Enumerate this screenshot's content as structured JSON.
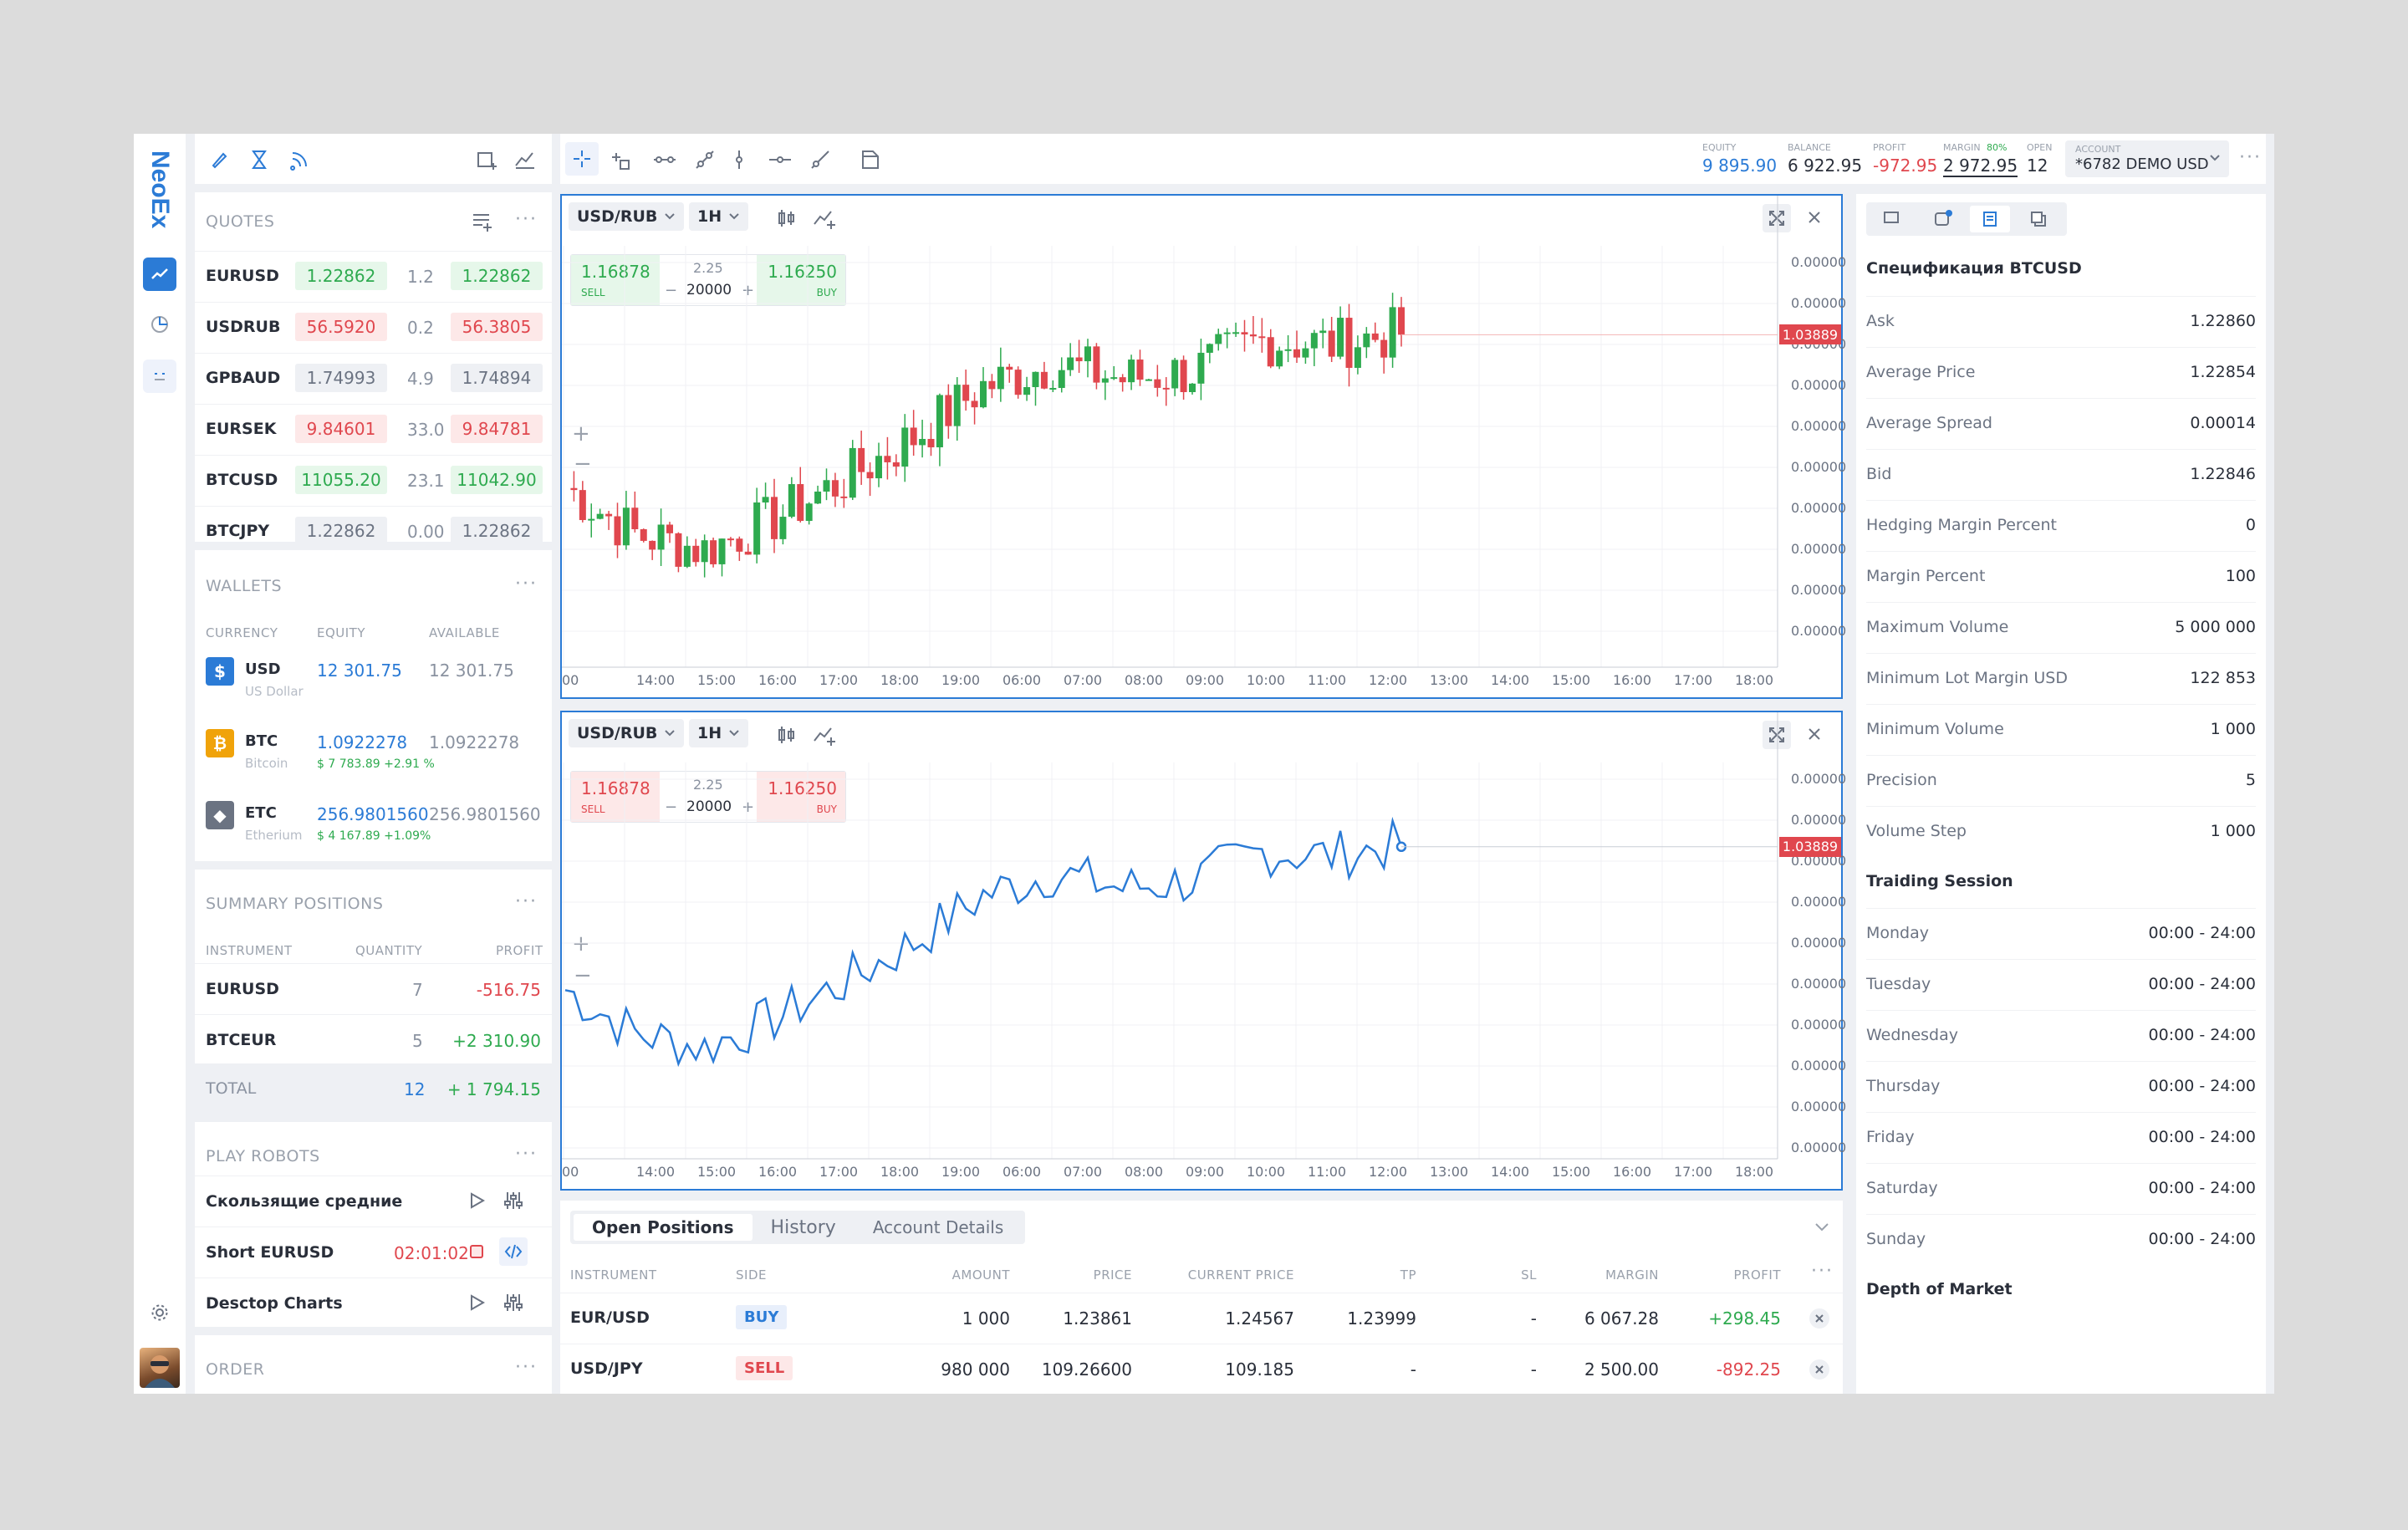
{
  "app": {
    "logo": "NeoEx"
  },
  "topbar": {
    "stats": [
      {
        "label": "EQUITY",
        "value": "9 895.90",
        "color": "#2b7bd6"
      },
      {
        "label": "BALANCE",
        "value": "6 922.95",
        "color": "#2a2f3a"
      },
      {
        "label": "PROFIT",
        "value": "-972.95",
        "color": "#e0474e"
      },
      {
        "label": "MARGIN",
        "extra": "80%",
        "value": "2 972.95",
        "color": "#2a2f3a"
      },
      {
        "label": "OPEN",
        "value": "12",
        "color": "#2a2f3a"
      }
    ],
    "account": {
      "label": "ACCOUNT",
      "value": "*6782 DEMO USD"
    }
  },
  "quotes": {
    "title": "QUOTES",
    "rows": [
      {
        "symbol": "EURUSD",
        "bid": "1.22862",
        "spread": "1.2",
        "ask": "1.22862",
        "bidc": "g",
        "askc": "g"
      },
      {
        "symbol": "USDRUB",
        "bid": "56.5920",
        "spread": "0.2",
        "ask": "56.3805",
        "bidc": "r",
        "askc": "r"
      },
      {
        "symbol": "GPBAUD",
        "bid": "1.74993",
        "spread": "4.9",
        "ask": "1.74894",
        "bidc": "n",
        "askc": "n"
      },
      {
        "symbol": "EURSEK",
        "bid": "9.84601",
        "spread": "33.0",
        "ask": "9.84781",
        "bidc": "r",
        "askc": "r"
      },
      {
        "symbol": "BTCUSD",
        "bid": "11055.20",
        "spread": "23.1",
        "ask": "11042.90",
        "bidc": "g",
        "askc": "g"
      },
      {
        "symbol": "BTCJPY",
        "bid": "1.22862",
        "spread": "0.00",
        "ask": "1.22862",
        "bidc": "n",
        "askc": "n"
      }
    ]
  },
  "wallets": {
    "title": "WALLETS",
    "cols": [
      "CURRENCY",
      "EQUITY",
      "AVAILABLE"
    ],
    "rows": [
      {
        "code": "USD",
        "name": "US Dollar",
        "equity": "12 301.75",
        "available": "12 301.75",
        "sub": "",
        "icon": "$",
        "color": "#2b7bd6"
      },
      {
        "code": "BTC",
        "name": "Bitcoin",
        "equity": "1.0922278",
        "available": "1.0922278",
        "sub": "$ 7 783.89  +2.91 %",
        "icon": "₿",
        "color": "#f0a30a"
      },
      {
        "code": "ETC",
        "name": "Etherium",
        "equity": "256.9801560",
        "available": "256.9801560",
        "sub": "$ 4 167.89  +1.09%",
        "icon": "◆",
        "color": "#6b7382"
      }
    ]
  },
  "summary": {
    "title": "SUMMARY POSITIONS",
    "cols": [
      "INSTRUMENT",
      "QUANTITY",
      "PROFIT"
    ],
    "rows": [
      {
        "instrument": "EURUSD",
        "qty": "7",
        "profit": "-516.75",
        "pc": "red"
      },
      {
        "instrument": "BTCEUR",
        "qty": "5",
        "profit": "+2 310.90",
        "pc": "green"
      }
    ],
    "total": {
      "label": "TOTAL",
      "qty": "12",
      "profit": "+ 1 794.15"
    }
  },
  "robots": {
    "title": "PLAY ROBOTS",
    "rows": [
      {
        "name": "Скользящие средние",
        "timer": ""
      },
      {
        "name": "Short EURUSD",
        "timer": "02:01:02"
      },
      {
        "name": "Desctop Charts",
        "timer": ""
      }
    ]
  },
  "order": {
    "title": "ORDER"
  },
  "chart_widget": {
    "pair": "USD/RUB",
    "tf": "1H",
    "sell": "1.16878",
    "sell_label": "SELL",
    "buy": "1.16250",
    "buy_label": "BUY",
    "spread": "2.25",
    "amount": "20000",
    "minus": "−",
    "plus": "+",
    "current": "1.03889",
    "ylabels": [
      "0.00000",
      "0.00000",
      "0.00000",
      "0.00000",
      "0.00000",
      "0.00000",
      "0.00000",
      "0.00000",
      "0.00000",
      "0.00000"
    ],
    "xlabels": [
      "00",
      "14:00",
      "15:00",
      "16:00",
      "17:00",
      "18:00",
      "19:00",
      "06:00",
      "07:00",
      "08:00",
      "09:00",
      "10:00",
      "11:00",
      "12:00",
      "13:00",
      "14:00",
      "15:00",
      "16:00",
      "17:00",
      "18:00"
    ]
  },
  "chart_data": [
    {
      "type": "candlestick",
      "x": [
        "14:00",
        "15:00",
        "16:00",
        "17:00",
        "18:00",
        "19:00",
        "06:00",
        "07:00",
        "08:00",
        "09:00",
        "10:00",
        "11:00",
        "12:00"
      ],
      "close": [
        0.42,
        0.3,
        0.26,
        0.34,
        0.44,
        0.55,
        0.68,
        0.74,
        0.7,
        0.72,
        0.8,
        0.79,
        0.82
      ],
      "ylim": [
        0,
        1
      ]
    },
    {
      "type": "line",
      "x": [
        "14:00",
        "15:00",
        "16:00",
        "17:00",
        "18:00",
        "19:00",
        "06:00",
        "07:00",
        "08:00",
        "09:00",
        "10:00",
        "11:00",
        "12:00"
      ],
      "values": [
        0.42,
        0.3,
        0.26,
        0.34,
        0.44,
        0.55,
        0.68,
        0.74,
        0.7,
        0.72,
        0.8,
        0.79,
        0.82
      ],
      "ylim": [
        0,
        1
      ]
    }
  ],
  "positions": {
    "tabs": [
      "Open Positions",
      "History",
      "Account Details"
    ],
    "cols": [
      "INSTRUMENT",
      "SIDE",
      "AMOUNT",
      "PRICE",
      "CURRENT PRICE",
      "TP",
      "SL",
      "MARGIN",
      "PROFIT"
    ],
    "rows": [
      {
        "instrument": "EUR/USD",
        "side": "BUY",
        "amount": "1 000",
        "price": "1.23861",
        "current": "1.24567",
        "tp": "1.23999",
        "sl": "-",
        "margin": "6 067.28",
        "profit": "+298.45",
        "pc": "green"
      },
      {
        "instrument": "USD/JPY",
        "side": "SELL",
        "amount": "980 000",
        "price": "109.26600",
        "current": "109.185",
        "tp": "-",
        "sl": "-",
        "margin": "2 500.00",
        "profit": "-892.25",
        "pc": "red"
      }
    ]
  },
  "spec": {
    "title": "Спецификация BTCUSD",
    "rows": [
      {
        "k": "Ask",
        "v": "1.22860"
      },
      {
        "k": "Average Price",
        "v": "1.22854"
      },
      {
        "k": "Average Spread",
        "v": "0.00014"
      },
      {
        "k": "Bid",
        "v": "1.22846"
      },
      {
        "k": "Hedging Margin Percent",
        "v": "0"
      },
      {
        "k": "Margin Percent",
        "v": "100"
      },
      {
        "k": "Maximum Volume",
        "v": "5 000 000"
      },
      {
        "k": "Minimum Lot Margin USD",
        "v": "122 853"
      },
      {
        "k": "Minimum Volume",
        "v": "1 000"
      },
      {
        "k": "Precision",
        "v": "5"
      },
      {
        "k": "Volume Step",
        "v": "1 000"
      }
    ],
    "session_title": "Traiding Session",
    "session": [
      {
        "k": "Monday",
        "v": "00:00 - 24:00"
      },
      {
        "k": "Tuesday",
        "v": "00:00 - 24:00"
      },
      {
        "k": "Wednesday",
        "v": "00:00 - 24:00"
      },
      {
        "k": "Thursday",
        "v": "00:00 - 24:00"
      },
      {
        "k": "Friday",
        "v": "00:00 - 24:00"
      },
      {
        "k": "Saturday",
        "v": "00:00 - 24:00"
      },
      {
        "k": "Sunday",
        "v": "00:00 - 24:00"
      }
    ],
    "depth_title": "Depth of Market"
  }
}
